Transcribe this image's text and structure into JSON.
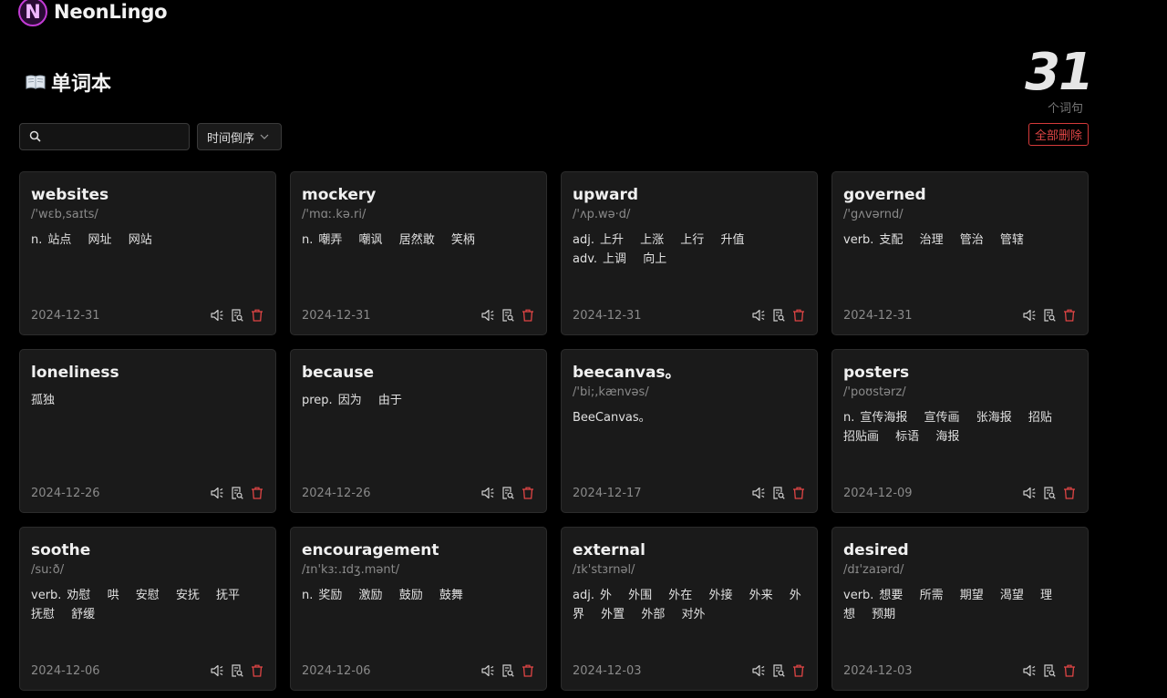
{
  "app": {
    "name": "NeonLingo",
    "logo_letter": "N"
  },
  "page": {
    "title": "单词本",
    "count": "31",
    "count_label": "个词句",
    "delete_all_label": "全部删除"
  },
  "search": {
    "placeholder": ""
  },
  "sort": {
    "selected": "时间倒序"
  },
  "colors": {
    "accent": "#c23bd4",
    "danger": "#e04545",
    "card_bg": "#1a1a1a"
  },
  "cards": [
    {
      "word": "websites",
      "phonetic": "/'wɛb,saɪts/",
      "defs": [
        {
          "pos": "n.",
          "meanings": [
            "站点",
            "网址",
            "网站"
          ]
        }
      ],
      "date": "2024-12-31"
    },
    {
      "word": "mockery",
      "phonetic": "/'mɑː.kə.ri/",
      "defs": [
        {
          "pos": "n.",
          "meanings": [
            "嘲弄",
            "嘲讽",
            "居然敢",
            "笑柄"
          ]
        }
      ],
      "date": "2024-12-31"
    },
    {
      "word": "upward",
      "phonetic": "/'ʌp.wə·d/",
      "defs": [
        {
          "pos": "adj.",
          "meanings": [
            "上升",
            "上涨",
            "上行",
            "升值"
          ]
        },
        {
          "pos": "adv.",
          "meanings": [
            "上调",
            "向上"
          ]
        }
      ],
      "date": "2024-12-31"
    },
    {
      "word": "governed",
      "phonetic": "/'gʌvərnd/",
      "defs": [
        {
          "pos": "verb.",
          "meanings": [
            "支配",
            "治理",
            "管治",
            "管辖"
          ]
        }
      ],
      "date": "2024-12-31"
    },
    {
      "word": "loneliness",
      "phonetic": "",
      "defs": [
        {
          "pos": "",
          "meanings": [
            "孤独"
          ]
        }
      ],
      "date": "2024-12-26"
    },
    {
      "word": "because",
      "phonetic": "",
      "defs": [
        {
          "pos": "prep.",
          "meanings": [
            "因为",
            "由于"
          ]
        }
      ],
      "date": "2024-12-26"
    },
    {
      "word": "beecanvas。",
      "phonetic": "/'bi;,kænvəs/",
      "defs": [
        {
          "pos": "",
          "meanings": [
            "BeeCanvas。"
          ]
        }
      ],
      "date": "2024-12-17"
    },
    {
      "word": "posters",
      "phonetic": "/'poʊstərz/",
      "defs": [
        {
          "pos": "n.",
          "meanings": [
            "宣传海报",
            "宣传画",
            "张海报",
            "招贴",
            "招贴画",
            "标语",
            "海报"
          ]
        }
      ],
      "date": "2024-12-09"
    },
    {
      "word": "soothe",
      "phonetic": "/suːð/",
      "defs": [
        {
          "pos": "verb.",
          "meanings": [
            "劝慰",
            "哄",
            "安慰",
            "安抚",
            "抚平",
            "抚慰",
            "舒缓"
          ]
        }
      ],
      "date": "2024-12-06"
    },
    {
      "word": "encouragement",
      "phonetic": "/ɪn'kɜː.ɪdʒ.mənt/",
      "defs": [
        {
          "pos": "n.",
          "meanings": [
            "奖励",
            "激励",
            "鼓励",
            "鼓舞"
          ]
        }
      ],
      "date": "2024-12-06"
    },
    {
      "word": "external",
      "phonetic": "/ɪk'stɜrnəl/",
      "defs": [
        {
          "pos": "adj.",
          "meanings": [
            "外",
            "外围",
            "外在",
            "外接",
            "外来",
            "外界",
            "外置",
            "外部",
            "对外"
          ]
        }
      ],
      "date": "2024-12-03"
    },
    {
      "word": "desired",
      "phonetic": "/dɪ'zaɪərd/",
      "defs": [
        {
          "pos": "verb.",
          "meanings": [
            "想要",
            "所需",
            "期望",
            "渴望",
            "理想",
            "预期"
          ]
        }
      ],
      "date": "2024-12-03"
    }
  ]
}
